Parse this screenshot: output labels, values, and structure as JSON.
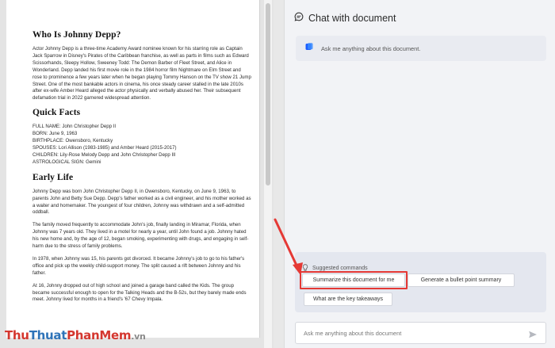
{
  "document": {
    "sections": [
      {
        "heading": "Who Is Johnny Depp?",
        "paragraphs": [
          "Actor Johnny Depp is a three-time Academy Award nominee known for his starring role as Captain Jack Sparrow in Disney's Pirates of the Caribbean franchise, as well as parts in films such as Edward Scissorhands, Sleepy Hollow, Sweeney Todd: The Demon Barber of Fleet Street, and Alice in Wonderland. Depp landed his first movie role in the 1984 horror film Nightmare on Elm Street and rose to prominence a few years later when he began playing Tommy Hanson on the TV show 21 Jump Street. One of the most bankable actors in cinema, his once steady career stalled in the late 2010s after ex-wife Amber Heard alleged the actor physically and verbally abused her. Their subsequent defamation trial in 2022 garnered widespread attention."
        ]
      },
      {
        "heading": "Quick Facts",
        "facts": [
          "FULL NAME: John Christopher Depp II",
          "BORN: June 9, 1963",
          "BIRTHPLACE: Owensboro, Kentucky",
          "SPOUSES: Lori Allison (1983-1985) and Amber Heard (2015-2017)",
          "CHILDREN: Lily-Rose Melody Depp and John Christopher Depp III",
          "ASTROLOGICAL SIGN: Gemini"
        ]
      },
      {
        "heading": "Early Life",
        "paragraphs": [
          "Johnny Depp was born John Christopher Depp II, in Owensboro, Kentucky, on June 9, 1963, to parents John and Betty Sue Depp. Depp's father worked as a civil engineer, and his mother worked as a waiter and homemaker. The youngest of four children, Johnny was withdrawn and a self-admitted oddball.",
          "The family moved frequently to accommodate John's job, finally landing in Miramar, Florida, when Johnny was 7 years old. They lived in a motel for nearly a year, until John found a job. Johnny hated his new home and, by the age of 12, began smoking, experimenting with drugs, and engaging in self-harm due to the stress of family problems.",
          "In 1978, when Johnny was 15, his parents got divorced. It became Johnny's job to go to his father's office and pick up the weekly child-support money. The split caused a rift between Johnny and his father.",
          "At 16, Johnny dropped out of high school and joined a garage band called the Kids. The group became successful enough to open for the Talking Heads and the B-52s, but they barely made ends meet. Johnny lived for months in a friend's '67 Chevy Impala."
        ]
      }
    ]
  },
  "chat": {
    "title": "Chat with document",
    "intro_message": "Ask me anything about this document.",
    "suggested_label": "Suggested commands",
    "commands": [
      "Summarize this document for me",
      "Generate a bullet point summary",
      "What are the key takeaways"
    ],
    "input_placeholder": "Ask me anything about this document",
    "input_value": ""
  },
  "icons": {
    "header": "chat-bubble-icon",
    "intro": "copilot-icon",
    "suggest": "lightbulb-icon",
    "send": "send-icon"
  },
  "watermark": {
    "part1": "Thu",
    "part2": "Thuat",
    "part3": "PhanMem",
    "part4": ".vn"
  },
  "colors": {
    "highlight": "#e53935",
    "accent": "#1a5cff"
  }
}
